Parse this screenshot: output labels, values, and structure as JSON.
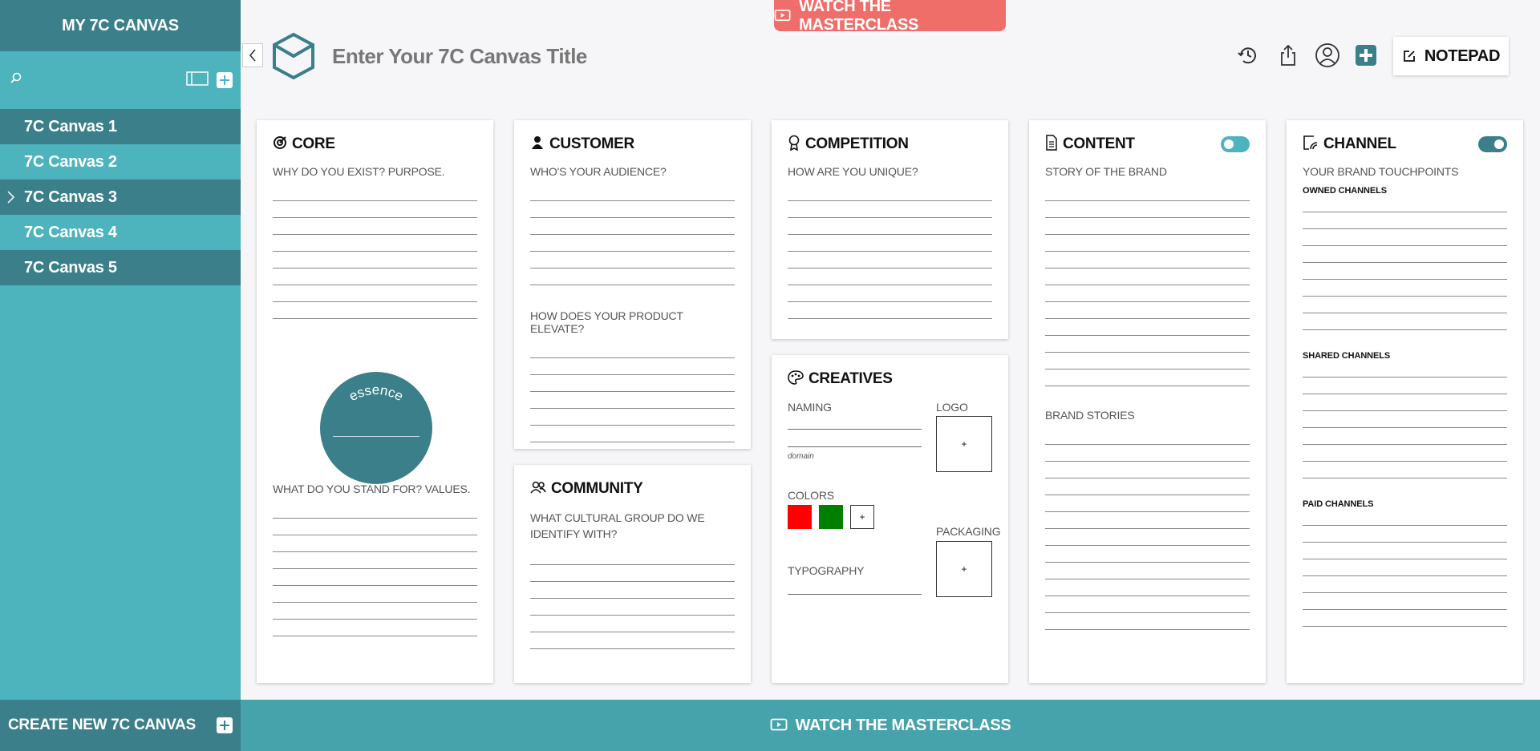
{
  "sidebar": {
    "title": "MY 7C CANVAS",
    "items": [
      {
        "label": "7C Canvas 1"
      },
      {
        "label": "7C Canvas 2"
      },
      {
        "label": "7C Canvas 3"
      },
      {
        "label": "7C Canvas 4"
      },
      {
        "label": "7C Canvas 5"
      }
    ],
    "create_label": "CREATE NEW 7C CANVAS"
  },
  "header": {
    "title_placeholder": "Enter Your 7C Canvas Title",
    "masterclass_label": "WATCH THE MASTERCLASS",
    "notepad_label": "NOTEPAD",
    "icons": [
      "history-icon",
      "share-icon",
      "profile-icon",
      "add-icon",
      "notepad-icon"
    ]
  },
  "cards": {
    "core": {
      "title": "CORE",
      "q1": "WHY DO YOU EXIST? PURPOSE.",
      "essence": "essence",
      "q2": "WHAT DO YOU STAND FOR? VALUES."
    },
    "customer": {
      "title": "CUSTOMER",
      "q1": "WHO'S YOUR AUDIENCE?",
      "q2": "HOW DOES YOUR PRODUCT ELEVATE?"
    },
    "community": {
      "title": "COMMUNITY",
      "q1": "WHAT CULTURAL GROUP DO WE IDENTIFY WITH?"
    },
    "competition": {
      "title": "COMPETITION",
      "q1": "HOW ARE YOU UNIQUE?"
    },
    "creatives": {
      "title": "CREATIVES",
      "naming": "NAMING",
      "domain": "domain",
      "logo": "LOGO",
      "colors": "COLORS",
      "swatches": [
        "#ff0000",
        "#008000"
      ],
      "packaging": "PACKAGING",
      "typography": "TYPOGRAPHY",
      "plus": "+"
    },
    "content": {
      "title": "CONTENT",
      "q1": "STORY OF THE BRAND",
      "q2": "BRAND STORIES",
      "toggle_on": false
    },
    "channel": {
      "title": "CHANNEL",
      "q1": "YOUR BRAND TOUCHPOINTS",
      "owned": "OWNED CHANNELS",
      "shared": "SHARED CHANNELS",
      "paid": "PAID CHANNELS",
      "toggle_on": true
    }
  },
  "footer": {
    "masterclass_label": "WATCH THE MASTERCLASS"
  },
  "colors": {
    "sidebar": "#4db3bd",
    "sidebar_dark": "#3a7f89",
    "masterclass_top": "#ef6e6a",
    "footer": "#46a3ab"
  }
}
